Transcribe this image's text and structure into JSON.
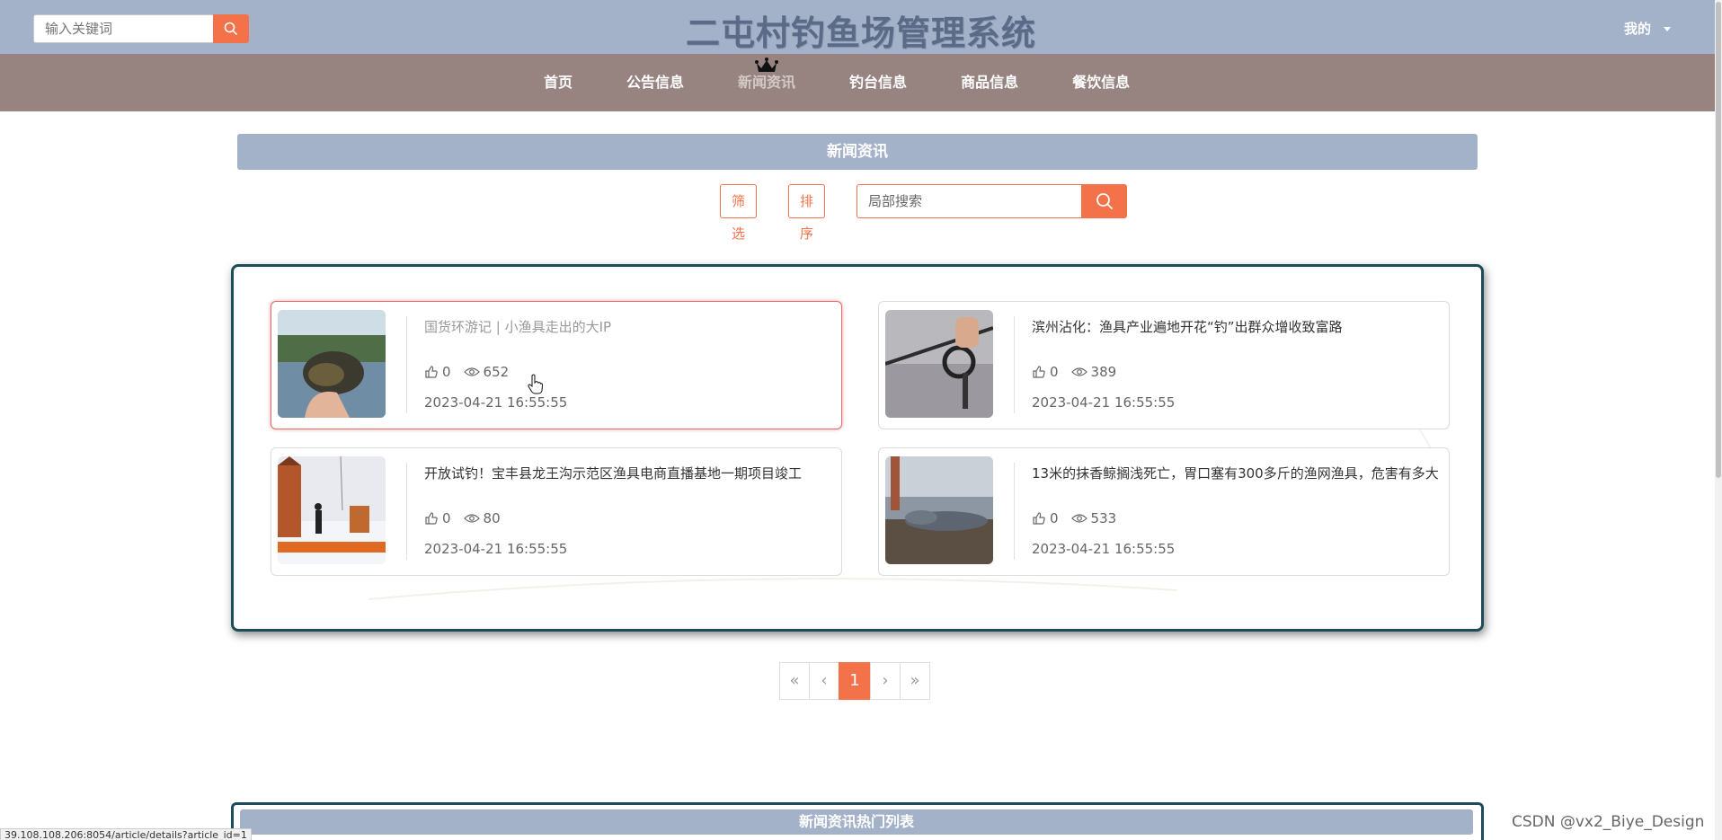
{
  "header": {
    "search_placeholder": "输入关键词",
    "site_title": "二屯村钓鱼场管理系统",
    "user_menu": "我的"
  },
  "nav": {
    "items": [
      {
        "label": "首页"
      },
      {
        "label": "公告信息"
      },
      {
        "label": "新闻资讯",
        "active": true
      },
      {
        "label": "钓台信息"
      },
      {
        "label": "商品信息"
      },
      {
        "label": "餐饮信息"
      }
    ]
  },
  "section": {
    "title": "新闻资讯",
    "filter_label": "筛选",
    "sort_label": "排序",
    "search_placeholder": "局部搜索"
  },
  "articles": [
    {
      "title": "国货环游记 | 小渔具走出的大IP",
      "likes": "0",
      "views": "652",
      "date": "2023-04-21 16:55:55"
    },
    {
      "title": "滨州沾化：渔具产业遍地开花“钓”出群众增收致富路",
      "likes": "0",
      "views": "389",
      "date": "2023-04-21 16:55:55"
    },
    {
      "title": "开放试钓！宝丰县龙王沟示范区渔具电商直播基地一期项目竣工",
      "likes": "0",
      "views": "80",
      "date": "2023-04-21 16:55:55"
    },
    {
      "title": "13米的抹香鲸搁浅死亡，胃口塞有300多斤的渔网渔具，危害有多大",
      "likes": "0",
      "views": "533",
      "date": "2023-04-21 16:55:55"
    }
  ],
  "pagination": {
    "first": "«",
    "prev": "‹",
    "current": "1",
    "next": "›",
    "last": "»"
  },
  "hot_list": {
    "title": "新闻资讯热门列表"
  },
  "status_url": "39.108.108.206:8054/article/details?article_id=1",
  "watermark": "CSDN @vx2_Biye_Design",
  "colors": {
    "header_bg": "#a3b1c9",
    "nav_bg": "#978480",
    "accent": "#f3724a",
    "panel_border": "#1c4c5a"
  }
}
